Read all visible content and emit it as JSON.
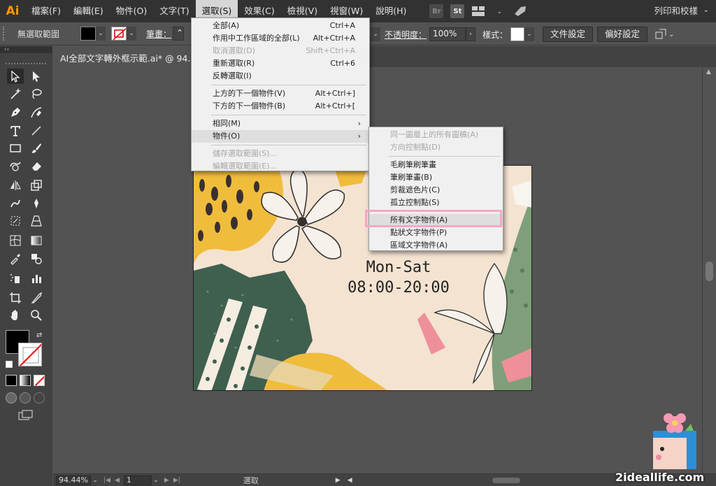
{
  "menubar": {
    "app_logo": "Ai",
    "items": [
      {
        "label": "檔案(F)"
      },
      {
        "label": "編輯(E)"
      },
      {
        "label": "物件(O)"
      },
      {
        "label": "文字(T)"
      },
      {
        "label": "選取(S)",
        "active": true
      },
      {
        "label": "效果(C)"
      },
      {
        "label": "檢視(V)"
      },
      {
        "label": "視窗(W)"
      },
      {
        "label": "說明(H)"
      }
    ],
    "bridge_label": "Br",
    "stock_label": "St",
    "workspace": "列印和校樣"
  },
  "controlbar": {
    "selection_state": "無選取範圍",
    "stroke_label": "筆畫：",
    "opacity_label": "不透明度：",
    "opacity_value": "100%",
    "style_label": "樣式：",
    "doc_setup_button": "文件設定",
    "preferences_button": "偏好設定"
  },
  "document": {
    "tab_title": "AI全部文字轉外框示範.ai* @ 94.4"
  },
  "artboard": {
    "text_line1": "Mon-Sat",
    "text_line2": "08:00-20:00"
  },
  "select_menu": {
    "items": [
      {
        "label": "全部(A)",
        "shortcut": "Ctrl+A"
      },
      {
        "label": "作用中工作區域的全部(L)",
        "shortcut": "Alt+Ctrl+A"
      },
      {
        "label": "取消選取(D)",
        "shortcut": "Shift+Ctrl+A",
        "disabled": true
      },
      {
        "label": "重新選取(R)",
        "shortcut": "Ctrl+6"
      },
      {
        "label": "反轉選取(I)",
        "shortcut": ""
      },
      {
        "label": "上方的下一個物件(V)",
        "shortcut": "Alt+Ctrl+]"
      },
      {
        "label": "下方的下一個物件(B)",
        "shortcut": "Alt+Ctrl+["
      },
      {
        "label": "相同(M)",
        "submenu": true
      },
      {
        "label": "物件(O)",
        "submenu": true,
        "hover": true
      },
      {
        "label": "儲存選取範圍(S)...",
        "disabled": true
      },
      {
        "label": "編輯選取範圍(E)...",
        "disabled": true
      }
    ]
  },
  "object_submenu": {
    "items": [
      {
        "label": "同一圖層上的所有圖稿(A)",
        "disabled": true
      },
      {
        "label": "方向控制點(D)",
        "disabled": true
      },
      {
        "label": "毛刷筆刷筆畫"
      },
      {
        "label": "筆刷筆畫(B)"
      },
      {
        "label": "剪裁遮色片(C)"
      },
      {
        "label": "孤立控制點(S)"
      },
      {
        "label": "所有文字物件(A)",
        "highlighted": true
      },
      {
        "label": "點狀文字物件(P)"
      },
      {
        "label": "區域文字物件(A)"
      }
    ]
  },
  "statusbar": {
    "zoom": "94.44%",
    "artboard_number": "1",
    "tool_name": "選取"
  },
  "watermark": "2ideallife.com",
  "colors": {
    "highlight": "#f7a6c6",
    "app_orange": "#ff9a00"
  }
}
